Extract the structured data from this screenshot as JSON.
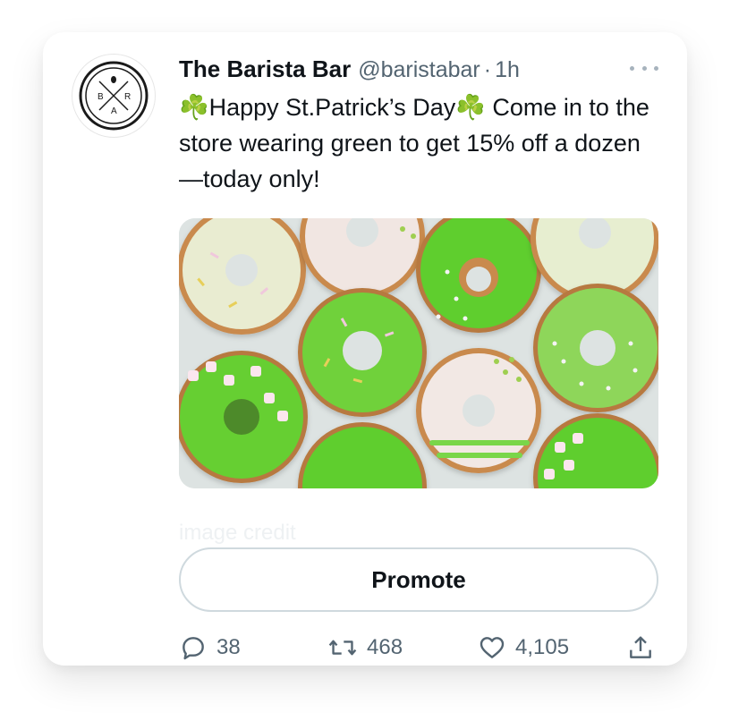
{
  "tweet": {
    "name": "The Barista Bar",
    "handle": "@baristabar",
    "separator": "·",
    "time": "1h",
    "text": "☘️Happy St.Patrick’s Day☘️ Come in to the store wearing green to get 15% off a dozen—today only!",
    "image_credit": "image credit",
    "promote_label": "Promote",
    "avatar_letters": [
      "B",
      "R",
      "A"
    ]
  },
  "actions": {
    "reply_count": "38",
    "retweet_count": "468",
    "like_count": "4,105"
  },
  "icons": {
    "reply": "reply-icon",
    "retweet": "retweet-icon",
    "like": "heart-icon",
    "share": "share-icon",
    "more": "more-icon"
  },
  "colors": {
    "primary_text": "#0f1419",
    "secondary_text": "#536471",
    "border": "#cfd9de",
    "donut_green": "#6fd13a"
  }
}
